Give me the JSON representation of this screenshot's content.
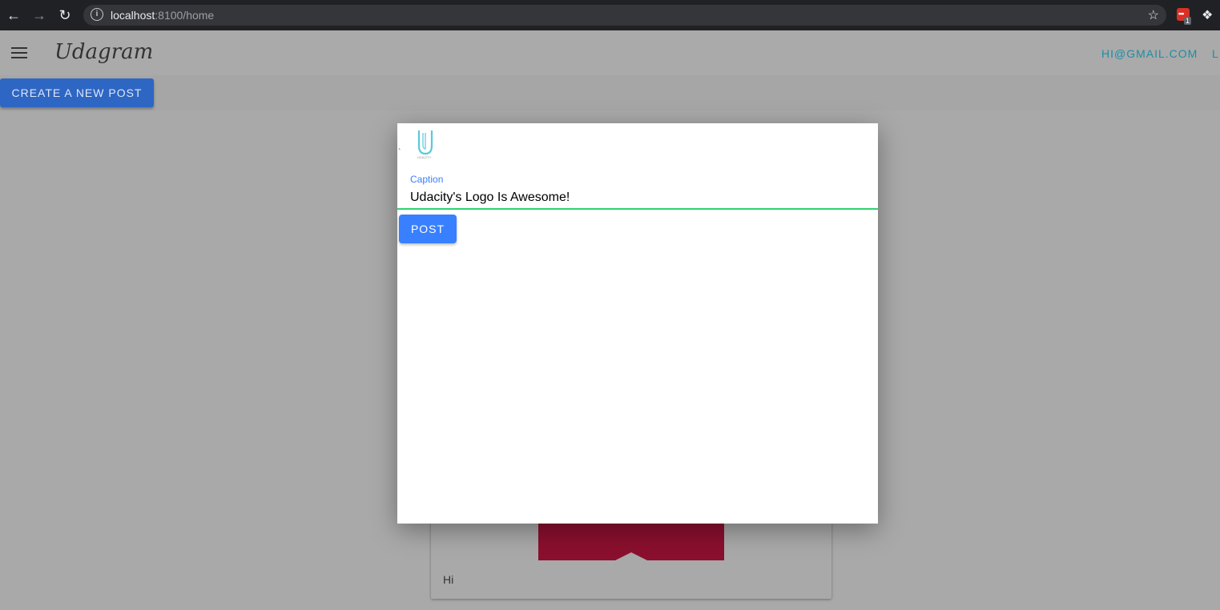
{
  "browser": {
    "url_host": "localhost",
    "url_path": ":8100/home",
    "extension_badge": "1"
  },
  "header": {
    "app_name": "Udagram",
    "user_email": "HI@GMAIL.COM",
    "logout_label": "L"
  },
  "toolbar": {
    "create_post_label": "CREATE A NEW POST"
  },
  "feed": {
    "items": [
      {
        "caption": "Hi"
      }
    ]
  },
  "modal": {
    "tick_mark": "`",
    "preview_text": "UDACITY",
    "caption_label": "Caption",
    "caption_value": "Udacity's Logo Is Awesome!",
    "post_label": "POST"
  },
  "colors": {
    "primary": "#3880ff",
    "input_underline": "#2dd36f",
    "header_link": "#1d8ea3"
  }
}
